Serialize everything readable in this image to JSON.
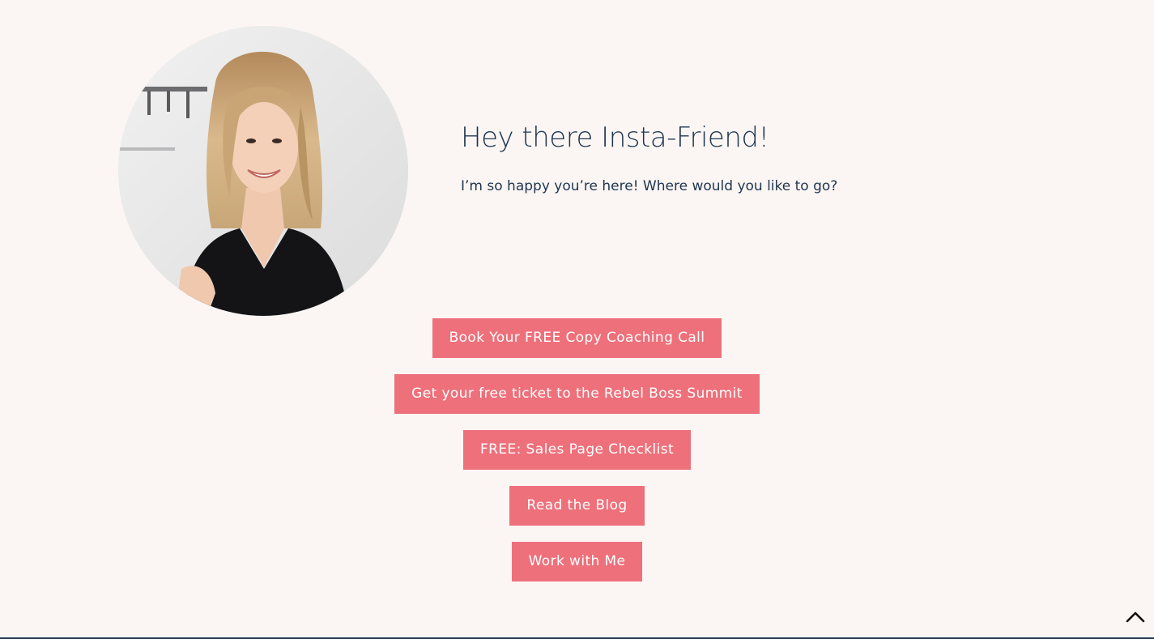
{
  "hero": {
    "title": "Hey there Insta-Friend!",
    "subtitle": "I’m so happy you’re here! Where would you like to go?",
    "avatar_alt": "Smiling woman with wavy blonde hair in a black top"
  },
  "links": [
    {
      "label": "Book Your FREE Copy Coaching Call"
    },
    {
      "label": "Get your free ticket to the Rebel Boss Summit"
    },
    {
      "label": "FREE: Sales Page Checklist"
    },
    {
      "label": "Read the Blog"
    },
    {
      "label": "Work with Me"
    }
  ],
  "back_to_top": {
    "icon": "chevron-up-icon"
  },
  "colors": {
    "background": "#fbf6f3",
    "heading": "#1f3550",
    "button": "#ee707b",
    "button_text": "#ffffff",
    "footer_line": "#1f3a56"
  }
}
